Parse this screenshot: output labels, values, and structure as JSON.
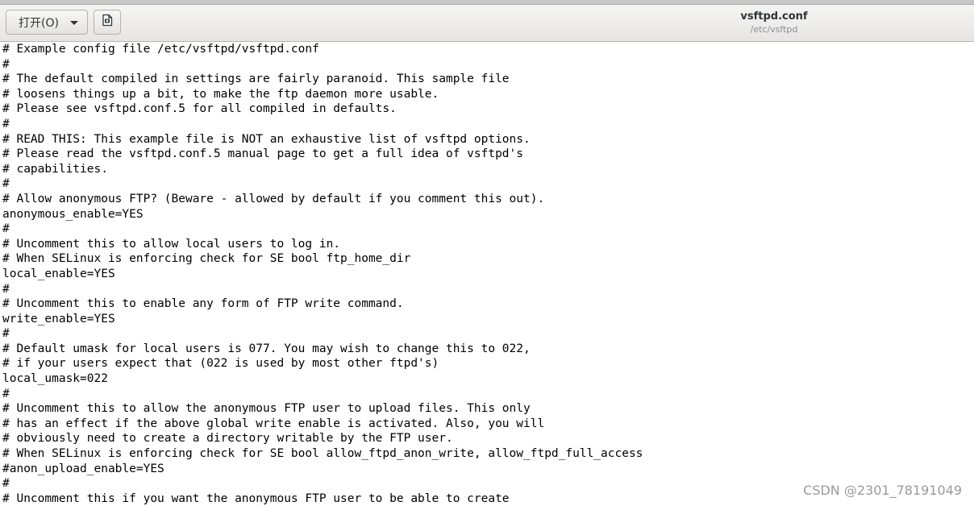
{
  "header": {
    "open_button_label": "打开(O)",
    "title": "vsftpd.conf",
    "subtitle": "/etc/vsftpd"
  },
  "icons": {
    "open_dropdown": "chevron-down-icon",
    "new_document": "new-document-icon"
  },
  "editor": {
    "lines": [
      "# Example config file /etc/vsftpd/vsftpd.conf",
      "#",
      "# The default compiled in settings are fairly paranoid. This sample file",
      "# loosens things up a bit, to make the ftp daemon more usable.",
      "# Please see vsftpd.conf.5 for all compiled in defaults.",
      "#",
      "# READ THIS: This example file is NOT an exhaustive list of vsftpd options.",
      "# Please read the vsftpd.conf.5 manual page to get a full idea of vsftpd's",
      "# capabilities.",
      "#",
      "# Allow anonymous FTP? (Beware - allowed by default if you comment this out).",
      "anonymous_enable=YES",
      "#",
      "# Uncomment this to allow local users to log in.",
      "# When SELinux is enforcing check for SE bool ftp_home_dir",
      "local_enable=YES",
      "#",
      "# Uncomment this to enable any form of FTP write command.",
      "write_enable=YES",
      "#",
      "# Default umask for local users is 077. You may wish to change this to 022,",
      "# if your users expect that (022 is used by most other ftpd's)",
      "local_umask=022",
      "#",
      "# Uncomment this to allow the anonymous FTP user to upload files. This only",
      "# has an effect if the above global write enable is activated. Also, you will",
      "# obviously need to create a directory writable by the FTP user.",
      "# When SELinux is enforcing check for SE bool allow_ftpd_anon_write, allow_ftpd_full_access",
      "#anon_upload_enable=YES",
      "#",
      "# Uncomment this if you want the anonymous FTP user to be able to create"
    ]
  },
  "watermark": "CSDN @2301_78191049",
  "colors": {
    "header_bg": "#e6e5e4",
    "text": "#000000",
    "subtitle": "#8b8e8f",
    "watermark": "#9a9a9a"
  }
}
